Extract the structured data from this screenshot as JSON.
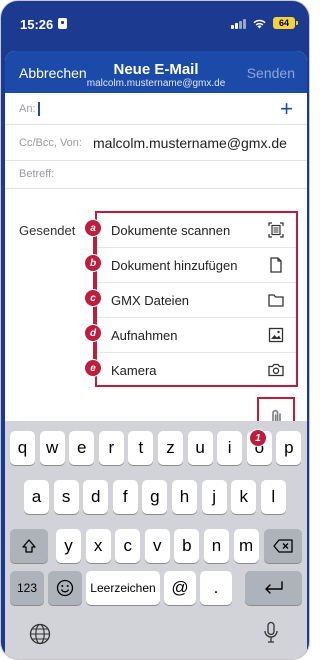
{
  "status": {
    "time": "15:26",
    "battery": "64"
  },
  "header": {
    "cancel": "Abbrechen",
    "title": "Neue E-Mail",
    "account": "malcolm.mustername@gmx.de",
    "send": "Senden"
  },
  "fields": {
    "to_label": "An:",
    "cc_label": "Cc/Bcc, Von:",
    "from_value": "malcolm.mustername@gmx.de",
    "subject_label": "Betreff:"
  },
  "body": {
    "sent_text": "Gesendet"
  },
  "attach_menu": {
    "items": [
      {
        "badge": "a",
        "label": "Dokumente scannen",
        "icon": "scan-document-icon"
      },
      {
        "badge": "b",
        "label": "Dokument hinzufügen",
        "icon": "file-icon"
      },
      {
        "badge": "c",
        "label": "GMX Dateien",
        "icon": "folder-icon"
      },
      {
        "badge": "d",
        "label": "Aufnahmen",
        "icon": "image-icon"
      },
      {
        "badge": "e",
        "label": "Kamera",
        "icon": "camera-icon"
      }
    ]
  },
  "attach_badge": "1",
  "keyboard": {
    "row1": [
      "q",
      "w",
      "e",
      "r",
      "t",
      "z",
      "u",
      "i",
      "o",
      "p"
    ],
    "row2": [
      "a",
      "s",
      "d",
      "f",
      "g",
      "h",
      "j",
      "k",
      "l"
    ],
    "row3": [
      "y",
      "x",
      "c",
      "v",
      "b",
      "n",
      "m"
    ],
    "numbers": "123",
    "space": "Leerzeichen",
    "at": "@",
    "dot": "."
  },
  "colors": {
    "brand": "#1c4aa8",
    "annotation": "#c01c3c"
  }
}
